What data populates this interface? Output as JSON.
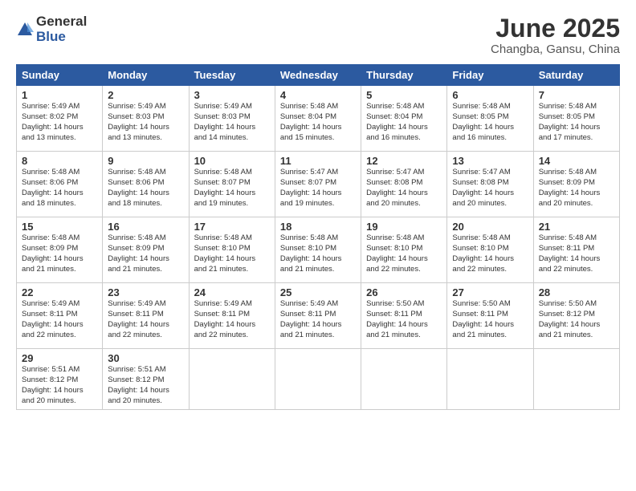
{
  "header": {
    "logo_general": "General",
    "logo_blue": "Blue",
    "month_title": "June 2025",
    "location": "Changba, Gansu, China"
  },
  "weekdays": [
    "Sunday",
    "Monday",
    "Tuesday",
    "Wednesday",
    "Thursday",
    "Friday",
    "Saturday"
  ],
  "weeks": [
    [
      {
        "day": 1,
        "sunrise": "5:49 AM",
        "sunset": "8:02 PM",
        "daylight": "14 hours and 13 minutes."
      },
      {
        "day": 2,
        "sunrise": "5:49 AM",
        "sunset": "8:03 PM",
        "daylight": "14 hours and 13 minutes."
      },
      {
        "day": 3,
        "sunrise": "5:49 AM",
        "sunset": "8:03 PM",
        "daylight": "14 hours and 14 minutes."
      },
      {
        "day": 4,
        "sunrise": "5:48 AM",
        "sunset": "8:04 PM",
        "daylight": "14 hours and 15 minutes."
      },
      {
        "day": 5,
        "sunrise": "5:48 AM",
        "sunset": "8:04 PM",
        "daylight": "14 hours and 16 minutes."
      },
      {
        "day": 6,
        "sunrise": "5:48 AM",
        "sunset": "8:05 PM",
        "daylight": "14 hours and 16 minutes."
      },
      {
        "day": 7,
        "sunrise": "5:48 AM",
        "sunset": "8:05 PM",
        "daylight": "14 hours and 17 minutes."
      }
    ],
    [
      {
        "day": 8,
        "sunrise": "5:48 AM",
        "sunset": "8:06 PM",
        "daylight": "14 hours and 18 minutes."
      },
      {
        "day": 9,
        "sunrise": "5:48 AM",
        "sunset": "8:06 PM",
        "daylight": "14 hours and 18 minutes."
      },
      {
        "day": 10,
        "sunrise": "5:48 AM",
        "sunset": "8:07 PM",
        "daylight": "14 hours and 19 minutes."
      },
      {
        "day": 11,
        "sunrise": "5:47 AM",
        "sunset": "8:07 PM",
        "daylight": "14 hours and 19 minutes."
      },
      {
        "day": 12,
        "sunrise": "5:47 AM",
        "sunset": "8:08 PM",
        "daylight": "14 hours and 20 minutes."
      },
      {
        "day": 13,
        "sunrise": "5:47 AM",
        "sunset": "8:08 PM",
        "daylight": "14 hours and 20 minutes."
      },
      {
        "day": 14,
        "sunrise": "5:48 AM",
        "sunset": "8:09 PM",
        "daylight": "14 hours and 20 minutes."
      }
    ],
    [
      {
        "day": 15,
        "sunrise": "5:48 AM",
        "sunset": "8:09 PM",
        "daylight": "14 hours and 21 minutes."
      },
      {
        "day": 16,
        "sunrise": "5:48 AM",
        "sunset": "8:09 PM",
        "daylight": "14 hours and 21 minutes."
      },
      {
        "day": 17,
        "sunrise": "5:48 AM",
        "sunset": "8:10 PM",
        "daylight": "14 hours and 21 minutes."
      },
      {
        "day": 18,
        "sunrise": "5:48 AM",
        "sunset": "8:10 PM",
        "daylight": "14 hours and 21 minutes."
      },
      {
        "day": 19,
        "sunrise": "5:48 AM",
        "sunset": "8:10 PM",
        "daylight": "14 hours and 22 minutes."
      },
      {
        "day": 20,
        "sunrise": "5:48 AM",
        "sunset": "8:10 PM",
        "daylight": "14 hours and 22 minutes."
      },
      {
        "day": 21,
        "sunrise": "5:48 AM",
        "sunset": "8:11 PM",
        "daylight": "14 hours and 22 minutes."
      }
    ],
    [
      {
        "day": 22,
        "sunrise": "5:49 AM",
        "sunset": "8:11 PM",
        "daylight": "14 hours and 22 minutes."
      },
      {
        "day": 23,
        "sunrise": "5:49 AM",
        "sunset": "8:11 PM",
        "daylight": "14 hours and 22 minutes."
      },
      {
        "day": 24,
        "sunrise": "5:49 AM",
        "sunset": "8:11 PM",
        "daylight": "14 hours and 22 minutes."
      },
      {
        "day": 25,
        "sunrise": "5:49 AM",
        "sunset": "8:11 PM",
        "daylight": "14 hours and 21 minutes."
      },
      {
        "day": 26,
        "sunrise": "5:50 AM",
        "sunset": "8:11 PM",
        "daylight": "14 hours and 21 minutes."
      },
      {
        "day": 27,
        "sunrise": "5:50 AM",
        "sunset": "8:11 PM",
        "daylight": "14 hours and 21 minutes."
      },
      {
        "day": 28,
        "sunrise": "5:50 AM",
        "sunset": "8:12 PM",
        "daylight": "14 hours and 21 minutes."
      }
    ],
    [
      {
        "day": 29,
        "sunrise": "5:51 AM",
        "sunset": "8:12 PM",
        "daylight": "14 hours and 20 minutes."
      },
      {
        "day": 30,
        "sunrise": "5:51 AM",
        "sunset": "8:12 PM",
        "daylight": "14 hours and 20 minutes."
      },
      null,
      null,
      null,
      null,
      null
    ]
  ]
}
